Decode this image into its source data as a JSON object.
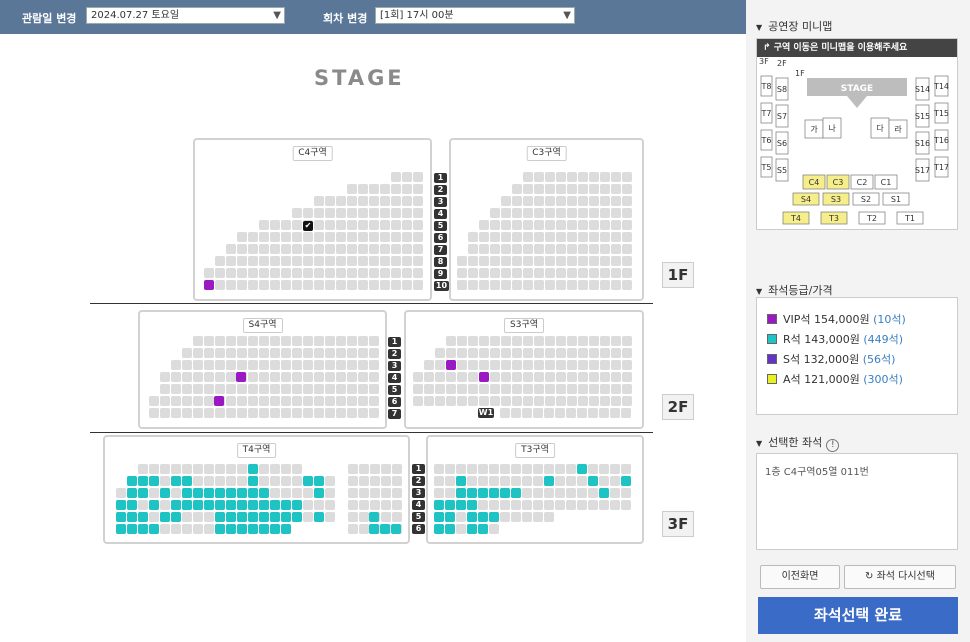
{
  "topbar": {
    "date_label": "관람일 변경",
    "date_value": "2024.07.27 토요일",
    "session_label": "회차 변경",
    "session_value": "[1회] 17시 00분"
  },
  "stage_label": "STAGE",
  "zones": {
    "c4": "C4구역",
    "c3": "C3구역",
    "s4": "S4구역",
    "s3": "S3구역",
    "t4": "T4구역",
    "t3": "T3구역"
  },
  "floors": {
    "f1": "1F",
    "f2": "2F",
    "f3": "3F"
  },
  "row_numbers": {
    "f1": [
      "1",
      "2",
      "3",
      "4",
      "5",
      "6",
      "7",
      "8",
      "9",
      "10"
    ],
    "f2": [
      "1",
      "2",
      "3",
      "4",
      "5",
      "6",
      "7"
    ],
    "f3": [
      "1",
      "2",
      "3",
      "4",
      "5",
      "6"
    ]
  },
  "wheelchair_label": "W1",
  "colors": {
    "available": "#dcdcdc",
    "vip": "#9a19c3",
    "r": "#1ec3c3",
    "s": "#6434c8",
    "a": "#e8f020",
    "selected": "#111111",
    "topbar": "#5a7797",
    "done_button": "#3a6bc7"
  },
  "right_panel": {
    "minimap_title": "공연장 미니맵",
    "minimap_banner": "구역 이동은 미니맵을 이용해주세요",
    "minimap_stage": "STAGE",
    "minimap_labels": {
      "floors": [
        "3F",
        "2F",
        "1F"
      ],
      "t_left": [
        "T8",
        "T7",
        "T6",
        "T5",
        "T4"
      ],
      "s_left": [
        "S8",
        "S7",
        "S6",
        "S5",
        "S4"
      ],
      "t_right": [
        "T14",
        "T15",
        "T16",
        "T17",
        "T1"
      ],
      "s_right": [
        "S14",
        "S15",
        "S16",
        "S17",
        "S1"
      ],
      "center": [
        "가",
        "나",
        "다",
        "라"
      ],
      "c_row": [
        "C4",
        "C3",
        "C2",
        "C1"
      ],
      "s_row": [
        "S4",
        "S3",
        "S2",
        "S1"
      ],
      "t_row": [
        "T4",
        "T3",
        "T2",
        "T1"
      ]
    },
    "legend_title": "좌석등급/가격",
    "legend": [
      {
        "name": "VIP석",
        "price": "154,000원",
        "count": "(10석)",
        "color": "#9a19c3"
      },
      {
        "name": "R석",
        "price": "143,000원",
        "count": "(449석)",
        "color": "#1ec3c3"
      },
      {
        "name": "S석",
        "price": "132,000원",
        "count": "(56석)",
        "color": "#6434c8"
      },
      {
        "name": "A석",
        "price": "121,000원",
        "count": "(300석)",
        "color": "#e8f020"
      }
    ],
    "selected_title": "선택한 좌석",
    "selected_info_icon": "!",
    "selected_seat": "1층 C4구역05열 011번",
    "prev_button": "이전화면",
    "reselect_button": "좌석 다시선택",
    "done_button": "좌석선택 완료"
  }
}
